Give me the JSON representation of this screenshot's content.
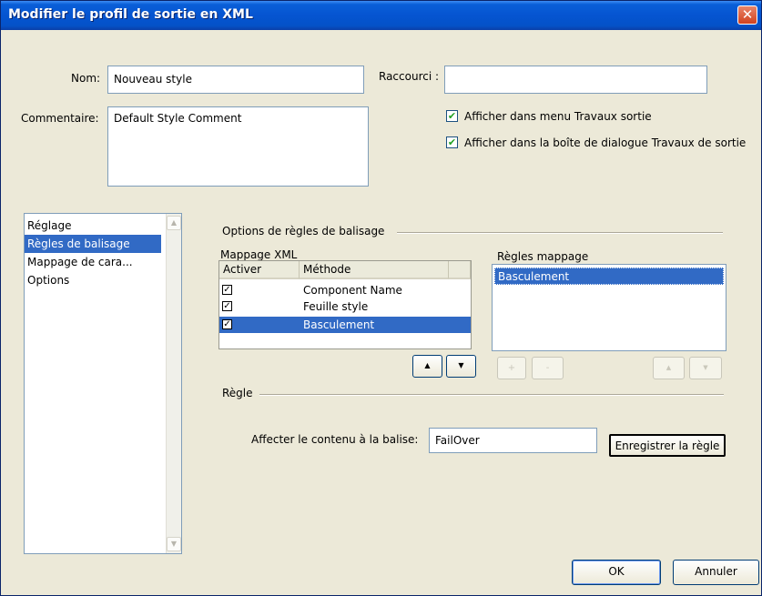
{
  "window": {
    "title": "Modifier le profil de sortie en XML",
    "close_glyph": "✕"
  },
  "form": {
    "name_label": "Nom:",
    "name_value": "Nouveau style",
    "shortcut_label": "Raccourci :",
    "shortcut_value": "",
    "comment_label": "Commentaire:",
    "comment_value": "Default Style Comment",
    "show_in_menu_label": "Afficher dans menu Travaux sortie",
    "show_in_menu_checked": true,
    "show_in_dialog_label": "Afficher dans la boîte de dialogue Travaux de sortie",
    "show_in_dialog_checked": true
  },
  "sidebar": {
    "items": [
      {
        "label": "Réglage",
        "selected": false
      },
      {
        "label": "Règles de balisage",
        "selected": true
      },
      {
        "label": "Mappage de cara...",
        "selected": false
      },
      {
        "label": "Options",
        "selected": false
      }
    ]
  },
  "tagging": {
    "group_title": "Options de règles de balisage",
    "xml_mapping_label": "Mappage XML",
    "col_activate": "Activer",
    "col_method": "Méthode",
    "rows": [
      {
        "checked": true,
        "method": "Component Name",
        "selected": false
      },
      {
        "checked": true,
        "method": "Feuille style",
        "selected": false
      },
      {
        "checked": true,
        "method": "Basculement",
        "selected": true
      }
    ],
    "mapping_rules_label": "Règles mappage",
    "mapping_rules": [
      {
        "label": "Basculement",
        "selected": true
      }
    ],
    "move_up_glyph": "▲",
    "move_down_glyph": "▼",
    "add_glyph": "+",
    "remove_glyph": "-"
  },
  "rule": {
    "group_title": "Règle",
    "assign_label": "Affecter le contenu à la balise:",
    "tag_value": "FailOver",
    "save_button": "Enregistrer la règle"
  },
  "footer": {
    "ok_label": "OK",
    "cancel_label": "Annuler"
  },
  "check_glyph": "✔",
  "box_check_glyph": "✓"
}
